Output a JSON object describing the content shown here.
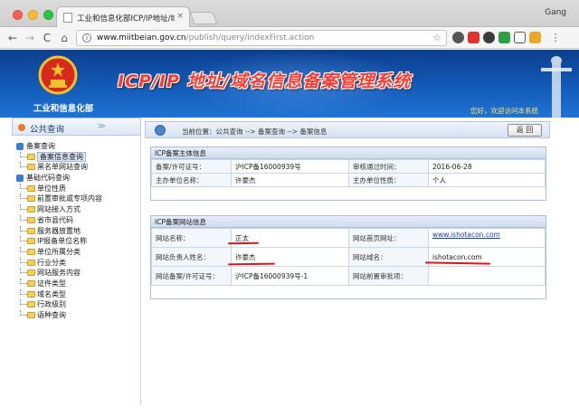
{
  "browser": {
    "tab_title": "工业和信息化部ICP/IP地址/域",
    "tab_close": "×",
    "profile_name": "Gang",
    "url_host": "www.miitbeian.gov.cn",
    "url_path": "/publish/query/indexFirst.action",
    "nav": {
      "back": "←",
      "forward": "→",
      "reload": "C",
      "home": "⌂"
    },
    "star": "☆"
  },
  "banner": {
    "ministry": "工业和信息化部",
    "title": "ICP/IP 地址/域名信息备案管理系统",
    "welcome": "您好，欢迎访问本系统"
  },
  "sidebar": {
    "header": "公共查询",
    "chevron": "≫",
    "tree": [
      {
        "type": "group",
        "label": "备案查询"
      },
      {
        "type": "child",
        "label": "备案信息查询",
        "active": true
      },
      {
        "type": "child",
        "label": "黑名单网站查询"
      },
      {
        "type": "group",
        "label": "基础代码查询"
      },
      {
        "type": "child",
        "label": "单位性质"
      },
      {
        "type": "child",
        "label": "前置审批或专项内容"
      },
      {
        "type": "child",
        "label": "网站接入方式"
      },
      {
        "type": "child",
        "label": "省市县代码"
      },
      {
        "type": "child",
        "label": "服务器放置地"
      },
      {
        "type": "child",
        "label": "IP报备单位名称"
      },
      {
        "type": "child",
        "label": "单位所属分类"
      },
      {
        "type": "child",
        "label": "行业分类"
      },
      {
        "type": "child",
        "label": "网站服务内容"
      },
      {
        "type": "child",
        "label": "证件类型"
      },
      {
        "type": "child",
        "label": "域名类型"
      },
      {
        "type": "child",
        "label": "行政级别"
      },
      {
        "type": "child",
        "label": "语种查询"
      }
    ]
  },
  "breadcrumb": {
    "text": "当前位置：公共查询 --> 备案查询 --> 备案信息",
    "back_button": "返 回"
  },
  "subject_panel": {
    "title": "ICP备案主体信息",
    "rows": [
      [
        "备案/许可证号：",
        "沪ICP备16000939号",
        "审核通过时间：",
        "2016-06-28"
      ],
      [
        "主办单位名称：",
        "许豪杰",
        "主办单位性质：",
        "个人"
      ]
    ]
  },
  "site_panel": {
    "title": "ICP备案网站信息",
    "rows": [
      [
        "网站名称：",
        "正太",
        "网站首页网址：",
        "www.ishotacon.com"
      ],
      [
        "网站负责人姓名：",
        "许豪杰",
        "网站域名：",
        "ishotacon.com"
      ],
      [
        "网站备案/许可证号：",
        "沪ICP备16000939号-1",
        "网站前置审批项：",
        ""
      ]
    ]
  }
}
